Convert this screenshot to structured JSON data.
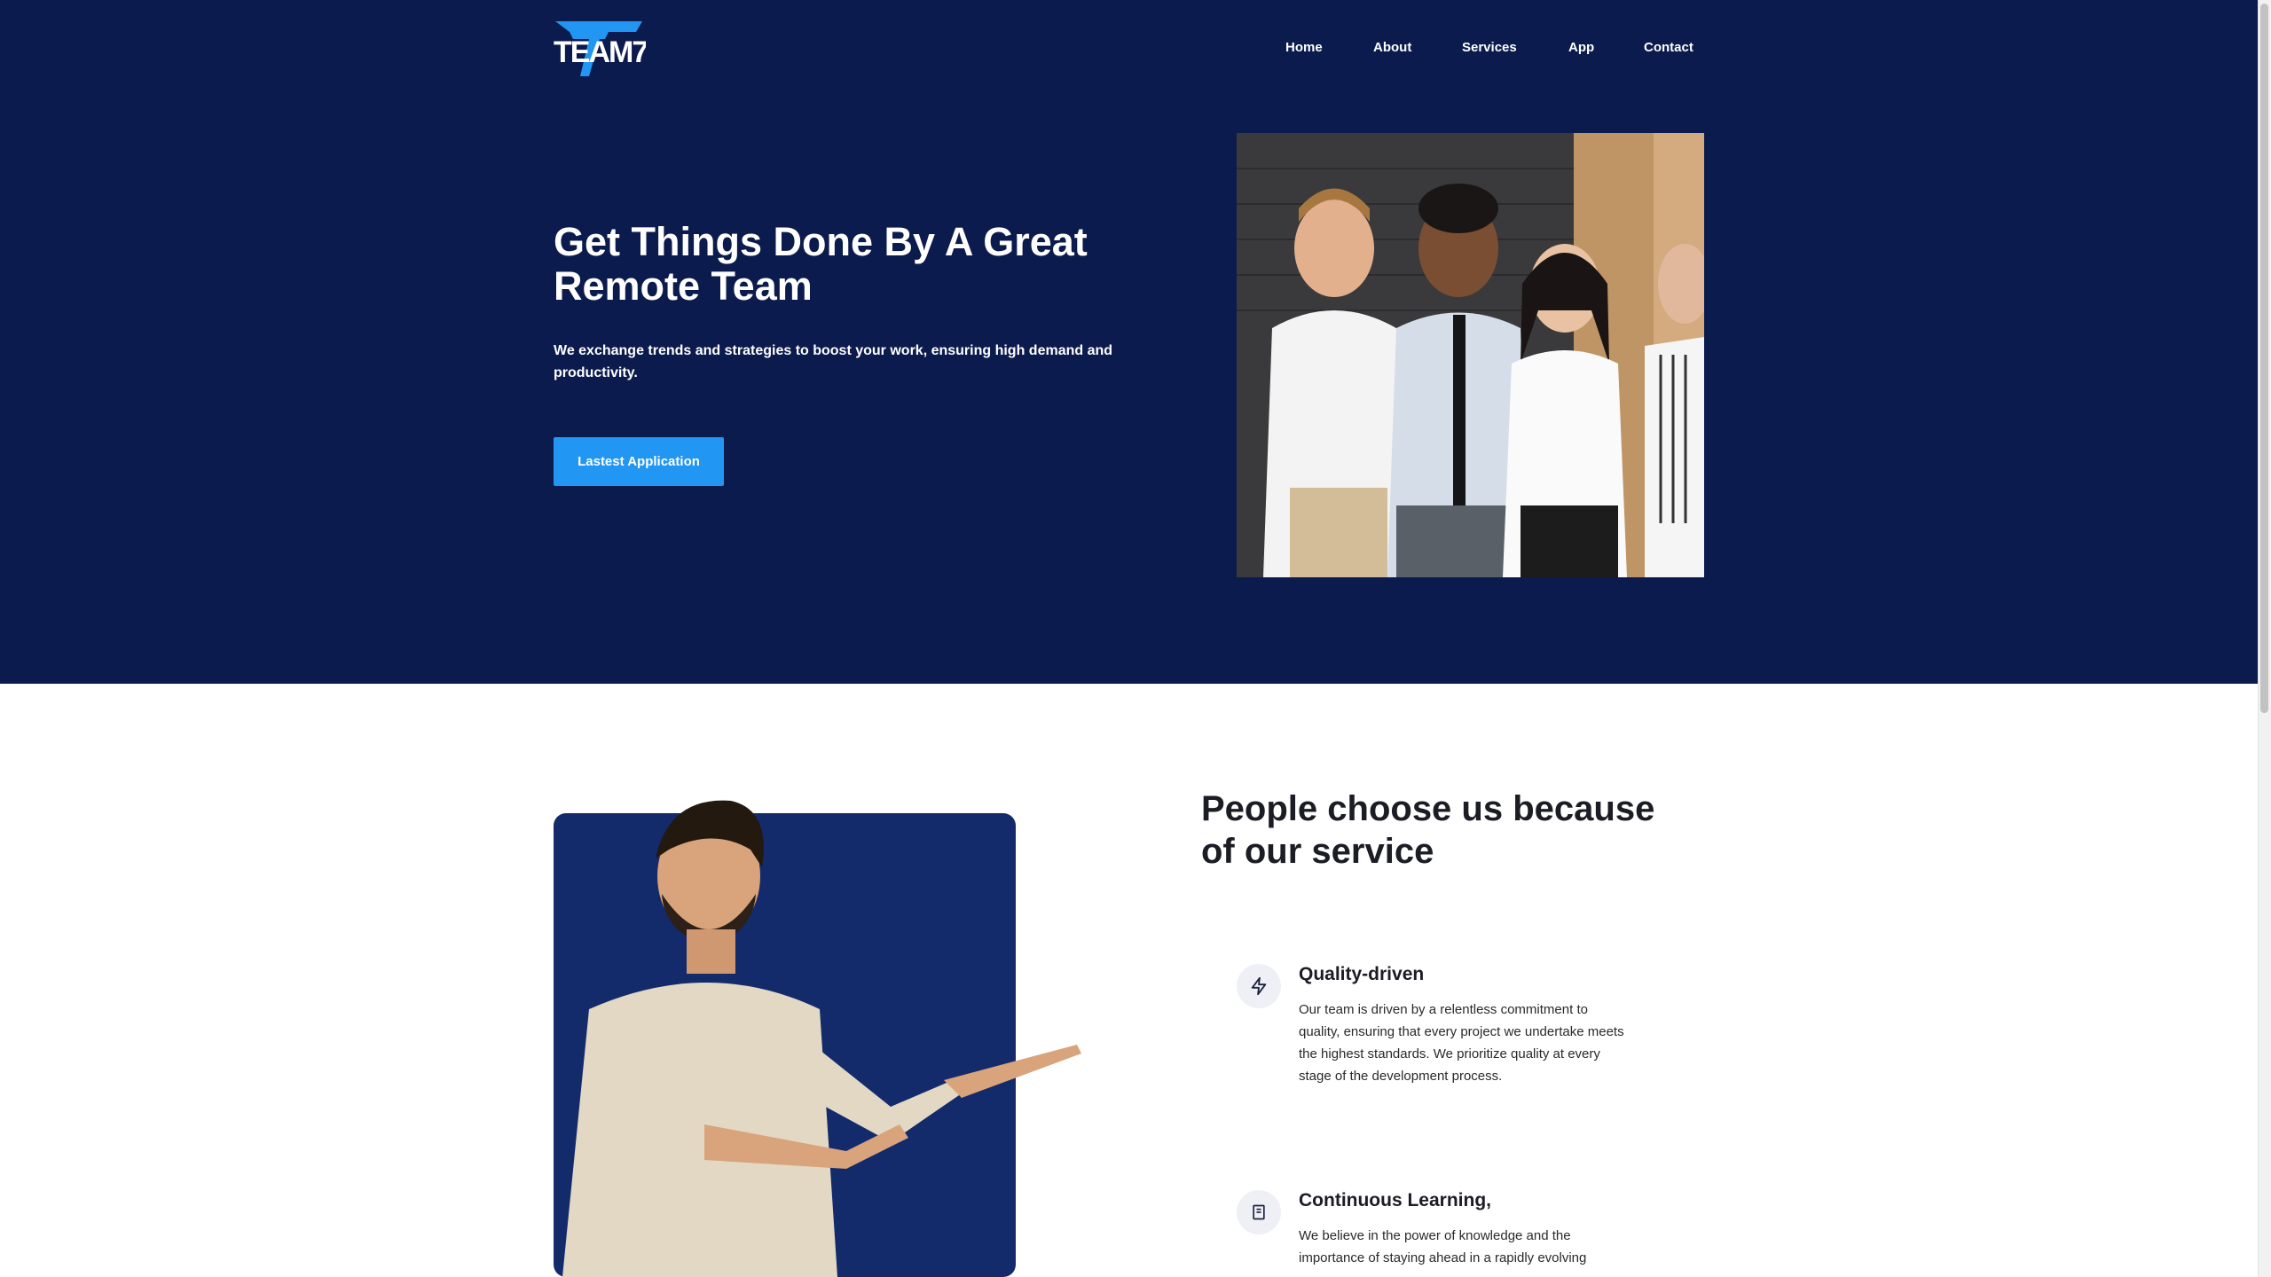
{
  "brand": {
    "logo_text": "TEAM7"
  },
  "nav": {
    "items": [
      "Home",
      "About",
      "Services",
      "App",
      "Contact"
    ]
  },
  "hero": {
    "title": "Get Things Done By A Great Remote Team",
    "subtitle": "We exchange trends and strategies to boost your work, ensuring high demand and productivity.",
    "cta_label": "Lastest Application"
  },
  "why": {
    "title": "People choose us because of our service",
    "features": [
      {
        "icon": "lightning-icon",
        "title": "Quality-driven",
        "text": "Our team is driven by a relentless commitment to quality, ensuring that every project we undertake meets the highest standards. We prioritize quality at every stage of the development process."
      },
      {
        "icon": "book-icon",
        "title": "Continuous Learning,",
        "text": "We believe in the power of knowledge and the importance of staying ahead in a rapidly evolving"
      }
    ]
  },
  "colors": {
    "hero_bg": "#0c1b4d",
    "accent": "#2196f3",
    "feature_panel": "#132b6b",
    "heading": "#1b1c24"
  }
}
